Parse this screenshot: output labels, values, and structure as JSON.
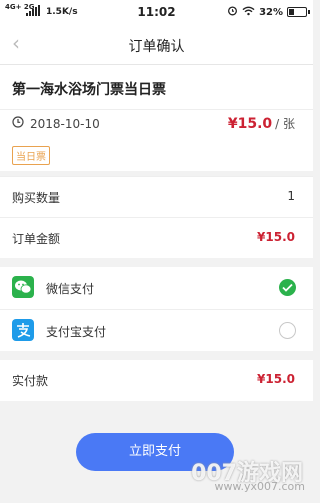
{
  "status_bar": {
    "network": "4G+ 2G",
    "speed": "1.5K/s",
    "time": "11:02",
    "battery": "32%"
  },
  "nav": {
    "title": "订单确认"
  },
  "product": {
    "title": "第一海水浴场门票当日票",
    "date": "2018-10-10",
    "price": "¥15.0",
    "price_unit": "/ 张",
    "badge": "当日票"
  },
  "order": {
    "quantity_label": "购买数量",
    "quantity_value": "1",
    "amount_label": "订单金额",
    "amount_value": "¥15.0"
  },
  "payment": {
    "methods": [
      {
        "label": "微信支付",
        "icon": "wechat-pay-icon",
        "selected": true,
        "color": "#2bb24c"
      },
      {
        "label": "支付宝支付",
        "icon": "alipay-icon",
        "selected": false,
        "color": "#1e9be9"
      }
    ]
  },
  "total": {
    "label": "实付款",
    "value": "¥15.0"
  },
  "button": {
    "pay_label": "立即支付"
  },
  "watermark": {
    "main": "007游戏网",
    "sub": "www.yx007.com"
  },
  "colors": {
    "accent": "#4a79f5",
    "price": "#cc2233",
    "badge": "#e9a24f"
  }
}
